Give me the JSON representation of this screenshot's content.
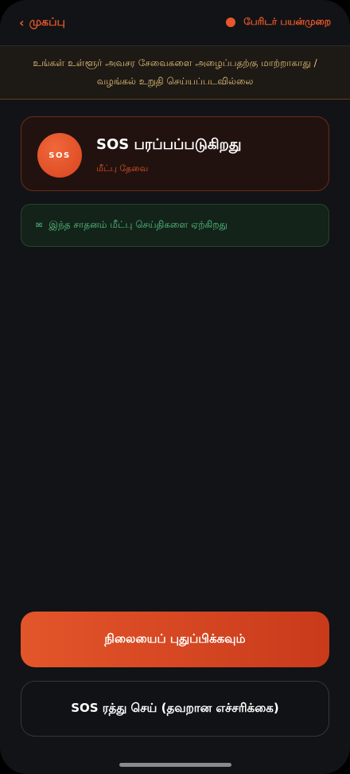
{
  "header": {
    "back_label": "முகப்பு",
    "back_icon": "chevron-left-icon",
    "mode_label": "பேரிடர் பயன்முறை",
    "mode_dot_color": "#e6572a"
  },
  "banner": {
    "text": "உங்கள் உள்ளூர் அவசர சேவைகளை அழைப்பதற்கு மாற்றாகாது / வழங்கல் உறுதி செய்யப்படவில்லை"
  },
  "sos_card": {
    "badge": "SOS",
    "title": "SOS பரப்பப்படுகிறது",
    "subtitle": "மீட்பு தேவை"
  },
  "status": {
    "icon": "envelope-icon",
    "text": "இந்த சாதனம் மீட்பு செய்திகளை ஏற்கிறது"
  },
  "actions": {
    "refresh_label": "நிலையைப் புதுப்பிக்கவும்",
    "cancel_label": "SOS ரத்து செய் (தவறான எச்சரிக்கை)"
  },
  "colors": {
    "accent": "#e6572a",
    "background": "#121316",
    "success": "#56c585",
    "warning_text": "#e4c07a"
  }
}
